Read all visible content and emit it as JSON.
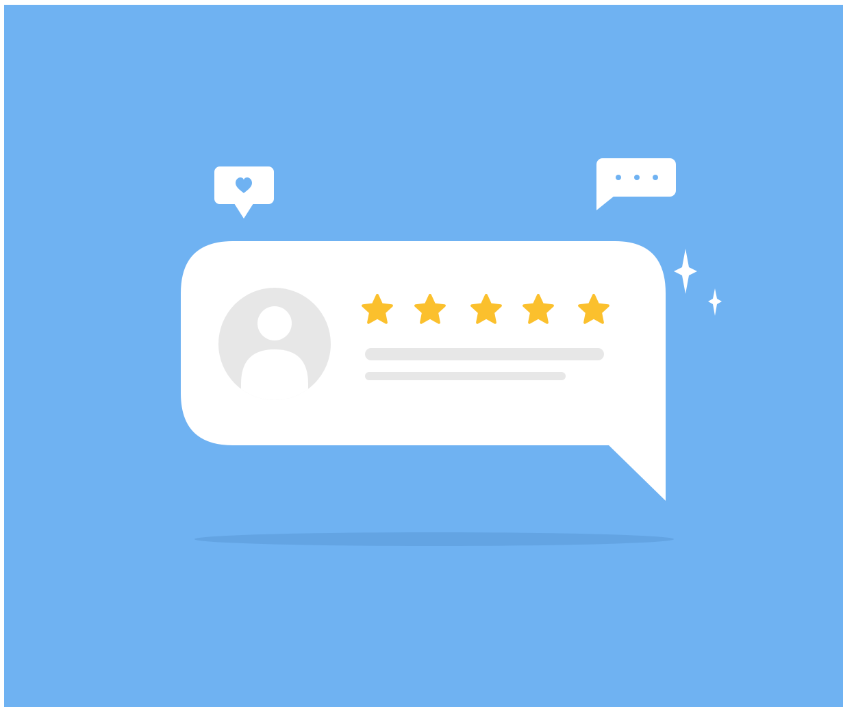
{
  "illustration": {
    "subject": "customer-review",
    "rating": {
      "value": 5,
      "max": 5
    },
    "icons": {
      "like_bubble": "heart-icon",
      "typing_bubble": "ellipsis-icon",
      "avatar": "user-avatar-icon",
      "sparkles": "sparkle-icon",
      "star": "star-icon"
    },
    "colors": {
      "background": "#6fb2f2",
      "card": "#ffffff",
      "star": "#fbc02d",
      "placeholder": "#e7e7e7",
      "accent": "#6fb2f2",
      "shadow": "#5f9fdd"
    }
  }
}
